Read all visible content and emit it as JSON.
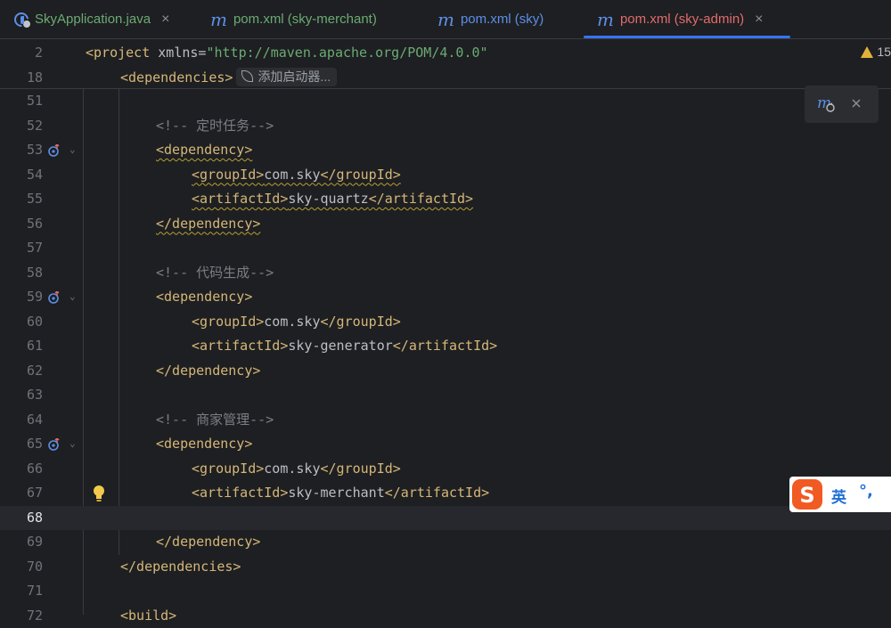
{
  "tabs": [
    {
      "label": "SkyApplication.java",
      "icon": "java-class-icon",
      "color": "#6aab73",
      "active": false,
      "closable": true
    },
    {
      "label": "pom.xml (sky-merchant)",
      "icon": "maven-icon",
      "color": "#6aab73",
      "active": false,
      "closable": false
    },
    {
      "label": "pom.xml (sky)",
      "icon": "maven-icon",
      "color": "#5c8fe6",
      "active": false,
      "closable": false
    },
    {
      "label": "pom.xml (sky-admin)",
      "icon": "maven-icon",
      "color": "#e06c6c",
      "active": true,
      "closable": true
    }
  ],
  "tab_close_glyph": "×",
  "sticky": {
    "line2_num": "2",
    "line2_tag_open": "<project",
    "line2_attr": " xmlns=",
    "line2_value": "\"http://maven.apache.org/POM/4.0.0\"",
    "line18_num": "18",
    "line18_tag": "<dependencies>",
    "hint_label": "添加启动器..."
  },
  "warnings": {
    "count": "15"
  },
  "lines": [
    {
      "n": "51"
    },
    {
      "n": "52",
      "comment": "<!-- 定时任务-->"
    },
    {
      "n": "53",
      "tag": "<dependency>"
    },
    {
      "n": "54",
      "open": "<groupId>",
      "text": "com.sky",
      "close": "</groupId>"
    },
    {
      "n": "55",
      "open": "<artifactId>",
      "text": "sky-quartz",
      "close": "</artifactId>"
    },
    {
      "n": "56",
      "tag": "</dependency>"
    },
    {
      "n": "57"
    },
    {
      "n": "58",
      "comment": "<!-- 代码生成-->"
    },
    {
      "n": "59",
      "tag": "<dependency>"
    },
    {
      "n": "60",
      "open": "<groupId>",
      "text": "com.sky",
      "close": "</groupId>"
    },
    {
      "n": "61",
      "open": "<artifactId>",
      "text": "sky-generator",
      "close": "</artifactId>"
    },
    {
      "n": "62",
      "tag": "</dependency>"
    },
    {
      "n": "63"
    },
    {
      "n": "64",
      "comment": "<!-- 商家管理-->"
    },
    {
      "n": "65",
      "tag": "<dependency>"
    },
    {
      "n": "66",
      "open": "<groupId>",
      "text": "com.sky",
      "close": "</groupId>"
    },
    {
      "n": "67",
      "open": "<artifactId>",
      "text": "sky-merchant",
      "close": "</artifactId>"
    },
    {
      "n": "68"
    },
    {
      "n": "69",
      "tag": "</dependency>"
    },
    {
      "n": "70",
      "tag": "</dependencies>"
    },
    {
      "n": "71"
    },
    {
      "n": "72",
      "tag": "<build>"
    }
  ],
  "ime": {
    "logo": "S",
    "lang": "英",
    "punct": "°,"
  },
  "colors": {
    "background": "#1e1f22",
    "tag": "#d5b778",
    "string": "#6aab73",
    "comment": "#7a7e85",
    "accent": "#3574f0",
    "warning": "#e2b13b",
    "ime_brand": "#f15a22"
  }
}
